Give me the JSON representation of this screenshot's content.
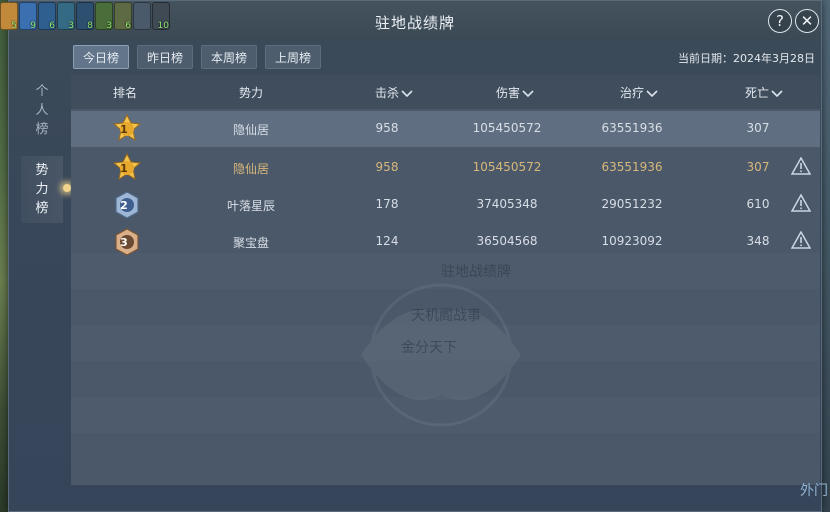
{
  "window": {
    "title": "驻地战绩牌",
    "help_label": "?",
    "close_label": "✕"
  },
  "tabs": [
    {
      "label": "今日榜",
      "active": true
    },
    {
      "label": "昨日榜",
      "active": false
    },
    {
      "label": "本周榜",
      "active": false
    },
    {
      "label": "上周榜",
      "active": false
    }
  ],
  "date_label": "当前日期：2024年3月28日",
  "side_tabs": [
    {
      "label": "个人榜",
      "active": false
    },
    {
      "label": "势力榜",
      "active": true
    }
  ],
  "columns": [
    "排名",
    "势力",
    "击杀",
    "伤害",
    "治疗",
    "死亡"
  ],
  "rows": [
    {
      "rank": "1",
      "faction": "隐仙居",
      "kills": "958",
      "damage": "105450572",
      "heal": "63551936",
      "deaths": "307",
      "style": "selected",
      "warn": false
    },
    {
      "rank": "1",
      "faction": "隐仙居",
      "kills": "958",
      "damage": "105450572",
      "heal": "63551936",
      "deaths": "307",
      "style": "highlight",
      "warn": true
    },
    {
      "rank": "2",
      "faction": "叶落星辰",
      "kills": "178",
      "damage": "37405348",
      "heal": "29051232",
      "deaths": "610",
      "style": "normal",
      "warn": true
    },
    {
      "rank": "3",
      "faction": "聚宝盘",
      "kills": "124",
      "damage": "36504568",
      "heal": "10923092",
      "deaths": "348",
      "style": "normal",
      "warn": true
    }
  ],
  "watermark": {
    "line1": "驻地战绩牌",
    "line2": "天机阁战事",
    "line3": "金分天下"
  },
  "corner_label": "外门",
  "buffs": [
    {
      "color": "#c08a3a",
      "n": "5"
    },
    {
      "color": "#3a6fb0",
      "n": "9"
    },
    {
      "color": "#2f5f8f",
      "n": "6"
    },
    {
      "color": "#356a85",
      "n": "3"
    },
    {
      "color": "#2d5070",
      "n": "8"
    },
    {
      "color": "#4a6e3a",
      "n": "3"
    },
    {
      "color": "#5e6a44",
      "n": "6"
    },
    {
      "color": "#4a5a6a",
      "n": ""
    },
    {
      "color": "#3f4a55",
      "n": "10"
    }
  ],
  "colors": {
    "accent_gold": "#d8b87a",
    "text": "#d8dee6",
    "panel": "#4a5869"
  }
}
